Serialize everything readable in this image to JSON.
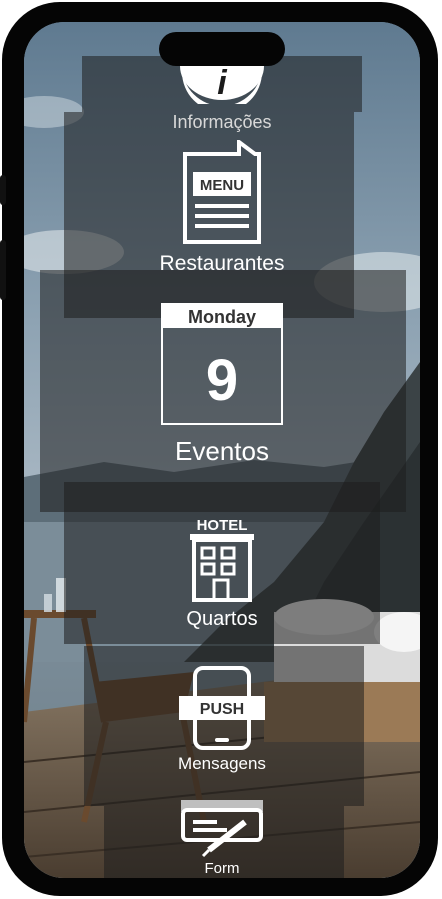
{
  "menu": {
    "informacoes": {
      "label": "Informações"
    },
    "restaurantes": {
      "label": "Restaurantes",
      "icon_text": "MENU"
    },
    "eventos": {
      "label": "Eventos",
      "weekday": "Monday",
      "day": "9"
    },
    "quartos": {
      "label": "Quartos",
      "icon_text": "HOTEL"
    },
    "mensagens": {
      "label": "Mensagens",
      "icon_text": "PUSH"
    },
    "form": {
      "label": "Form"
    }
  },
  "colors": {
    "icon_white": "#ffffff",
    "panel_shade": "#1e1e1e",
    "phone_frame": "#050505"
  }
}
